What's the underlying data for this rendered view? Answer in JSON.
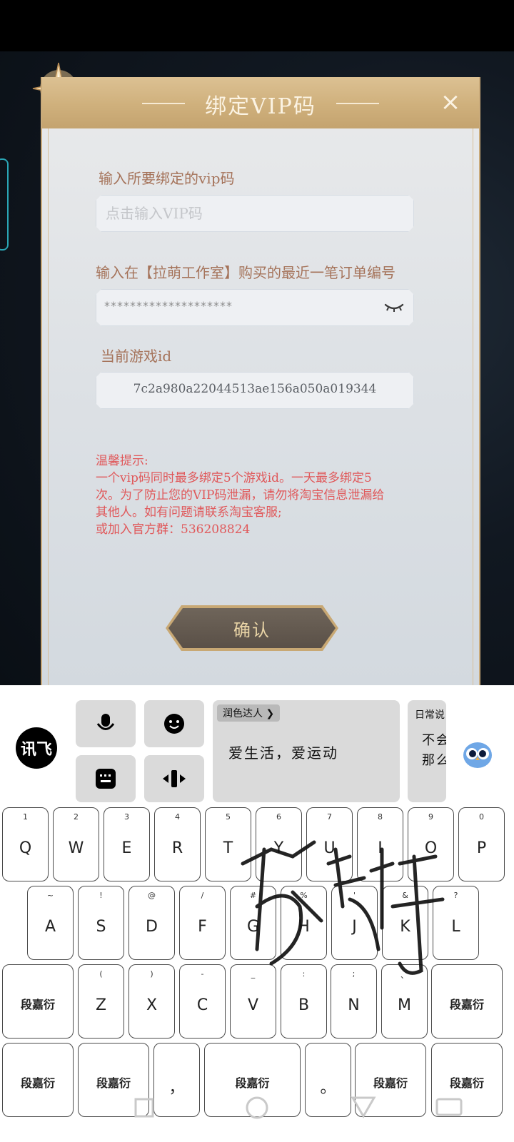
{
  "dialog": {
    "title": "绑定VIP码",
    "close_symbol": "×",
    "vip_label": "输入所要绑定的vip码",
    "vip_placeholder": "点击输入VIP码",
    "order_label": "输入在【拉萌工作室】购买的最近一笔订单编号",
    "order_value": "********************",
    "game_id_label": "当前游戏id",
    "game_id_value": "7c2a980a22044513ae156a050a019344",
    "notice_lines": [
      "温馨提示:",
      "一个vip码同时最多绑定5个游戏id。一天最多绑定5",
      "次。为了防止您的VIP码泄漏，请勿将淘宝信息泄漏给",
      "其他人。如有问题请联系淘宝客服;",
      "或加入官方群：536208824"
    ],
    "confirm_label": "确认"
  },
  "keyboard": {
    "logo_text": "讯飞",
    "card1_tag": "润色达人 ❯",
    "card1_text": "爱生活，爱运动",
    "card2_tag": "日常说",
    "card2_line1": "不会",
    "card2_line2": "那么",
    "row1": [
      {
        "hint": "1",
        "label": "Q"
      },
      {
        "hint": "2",
        "label": "W"
      },
      {
        "hint": "3",
        "label": "E"
      },
      {
        "hint": "4",
        "label": "R"
      },
      {
        "hint": "5",
        "label": "T"
      },
      {
        "hint": "6",
        "label": "Y"
      },
      {
        "hint": "7",
        "label": "U"
      },
      {
        "hint": "8",
        "label": "I"
      },
      {
        "hint": "9",
        "label": "O"
      },
      {
        "hint": "0",
        "label": "P"
      }
    ],
    "row2": [
      {
        "hint": "~",
        "label": "A"
      },
      {
        "hint": "!",
        "label": "S"
      },
      {
        "hint": "@",
        "label": "D"
      },
      {
        "hint": "/",
        "label": "F"
      },
      {
        "hint": "#",
        "label": "G"
      },
      {
        "hint": "%",
        "label": "H"
      },
      {
        "hint": "'",
        "label": "J"
      },
      {
        "hint": "&",
        "label": "K"
      },
      {
        "hint": "?",
        "label": "L"
      }
    ],
    "row3": [
      {
        "hint": "",
        "label": "段嘉衍"
      },
      {
        "hint": "(",
        "label": "Z"
      },
      {
        "hint": ")",
        "label": "X"
      },
      {
        "hint": "-",
        "label": "C"
      },
      {
        "hint": "_",
        "label": "V"
      },
      {
        "hint": ":",
        "label": "B"
      },
      {
        "hint": ";",
        "label": "N"
      },
      {
        "hint": "、",
        "label": "M"
      },
      {
        "hint": "",
        "label": "段嘉衍"
      }
    ],
    "row4": [
      {
        "label": "段嘉衍"
      },
      {
        "label": "段嘉衍"
      },
      {
        "label": "，"
      },
      {
        "label": "段嘉衍"
      },
      {
        "label": "。"
      },
      {
        "label": "段嘉衍"
      },
      {
        "label": "段嘉衍"
      }
    ],
    "signature_text": "段嘉衍"
  },
  "icons": {
    "close": "close-icon",
    "eye_closed": "eye-closed-icon",
    "mic": "microphone-icon",
    "emoji": "emoji-icon",
    "keyboard_grid": "keyboard-icon",
    "cursor": "cursor-move-icon",
    "owl": "owl-assistant-icon"
  },
  "colors": {
    "accent_gold": "#cfb07c",
    "label_brown": "#a5735a",
    "notice_red": "#e0585a"
  }
}
